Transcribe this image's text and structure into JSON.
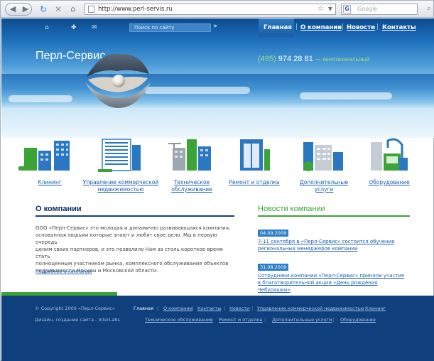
{
  "browser": {
    "url": "http://www.perl-servis.ru",
    "search_placeholder": "Google"
  },
  "topbar": {
    "search_placeholder": "Поиск по сайту",
    "search_go": "»",
    "nav": [
      "Главная",
      "О компании",
      "Новости",
      "Контакты"
    ]
  },
  "brand": {
    "name": "Перл-Сервис",
    "phone_code": "(495)",
    "phone_number": "974 28 81",
    "phone_suffix": "— многоканальный"
  },
  "services": [
    {
      "label_lines": [
        "Клининг"
      ]
    },
    {
      "label_lines": [
        "Управление коммерческой",
        "недвижимостью"
      ]
    },
    {
      "label_lines": [
        "Техническое",
        "обслуживание"
      ]
    },
    {
      "label_lines": [
        "Ремонт и отделка"
      ]
    },
    {
      "label_lines": [
        "Дополнительные",
        "услуги"
      ]
    },
    {
      "label_lines": [
        "Оборудование"
      ]
    }
  ],
  "about": {
    "title": "О компании",
    "text_lines": [
      "ООО «Перл-Сервис» это молодая и динамично развивающаяся компания,",
      "основанная людьми которые знают и любят свое дело. Мы в первую очередь",
      "ценим своих партнеров, и это позволило Нам за столь короткое время стать",
      "полноценным участником рынка, комплексного обслуживания объектов",
      "недвижимости Москвы и Московской области."
    ],
    "more": "Подробнее о компании"
  },
  "news": {
    "title": "Новости компании",
    "items": [
      {
        "date": "04.09.2009",
        "title_lines": [
          "7-11 сентября в «Перл-Сервис» состоится обучение",
          "региональных менеджеров компании"
        ]
      },
      {
        "date": "31.08.2009",
        "title_lines": [
          "Сотрудники компании «Перл-Сервис» приняли участие",
          "в благотворительной акции «День рождения Чебурашки»"
        ]
      }
    ]
  },
  "footer": {
    "copyright": "© Copyright 2009 «Перл-Сервис»",
    "design": "Дизайн, создание сайта - InterLabs",
    "nav_row1": [
      "Главная",
      "О компании",
      "Контакты",
      "Новости",
      "Управление коммерческой недвижимостью",
      "Клининг"
    ],
    "nav_row2": [
      "Техническое обслуживание",
      "Ремонт и отделка",
      "Дополнительные услуги",
      "Оборудование"
    ]
  },
  "colors": {
    "brand_blue": "#0f3f7d",
    "accent_green": "#3aa536",
    "link_blue": "#1a5fae"
  }
}
